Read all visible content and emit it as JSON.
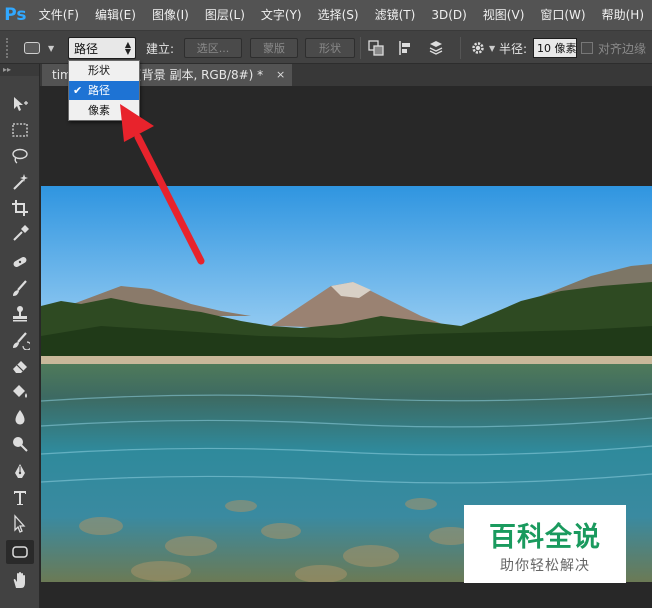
{
  "app": {
    "logo": "Ps"
  },
  "menu": [
    "文件(F)",
    "编辑(E)",
    "图像(I)",
    "图层(L)",
    "文字(Y)",
    "选择(S)",
    "滤镜(T)",
    "3D(D)",
    "视图(V)",
    "窗口(W)",
    "帮助(H)"
  ],
  "options": {
    "mode_value": "路径",
    "build_label": "建立:",
    "selection_button": "选区...",
    "mask_button": "蒙版",
    "shape_button": "形状",
    "radius_label": "半径:",
    "radius_value": "10 像素",
    "align_edges_label": "对齐边缘"
  },
  "mode_dropdown": {
    "options": [
      "形状",
      "路径",
      "像素"
    ],
    "selected": "路径",
    "check": "✔"
  },
  "document": {
    "tab_prefix": "tim",
    "tab_title": "% (背景 副本, RGB/8#) *",
    "close": "×"
  },
  "toolbar": {
    "collapse": "▸▸",
    "tools": [
      "move-tool",
      "marquee-tool",
      "lasso-tool",
      "magic-wand-tool",
      "crop-tool",
      "eyedropper-tool",
      "healing-brush-tool",
      "brush-tool",
      "clone-stamp-tool",
      "history-brush-tool",
      "eraser-tool",
      "paint-bucket-tool",
      "blur-tool",
      "dodge-tool",
      "pen-tool",
      "type-tool",
      "path-selection-tool",
      "rounded-rectangle-tool",
      "hand-tool"
    ],
    "active": "rounded-rectangle-tool"
  },
  "annotation": {
    "arrow_color": "#e8232c"
  },
  "watermark": {
    "title": "百科全说",
    "subtitle": "助你轻松解决",
    "color": "#1a9a5e"
  }
}
